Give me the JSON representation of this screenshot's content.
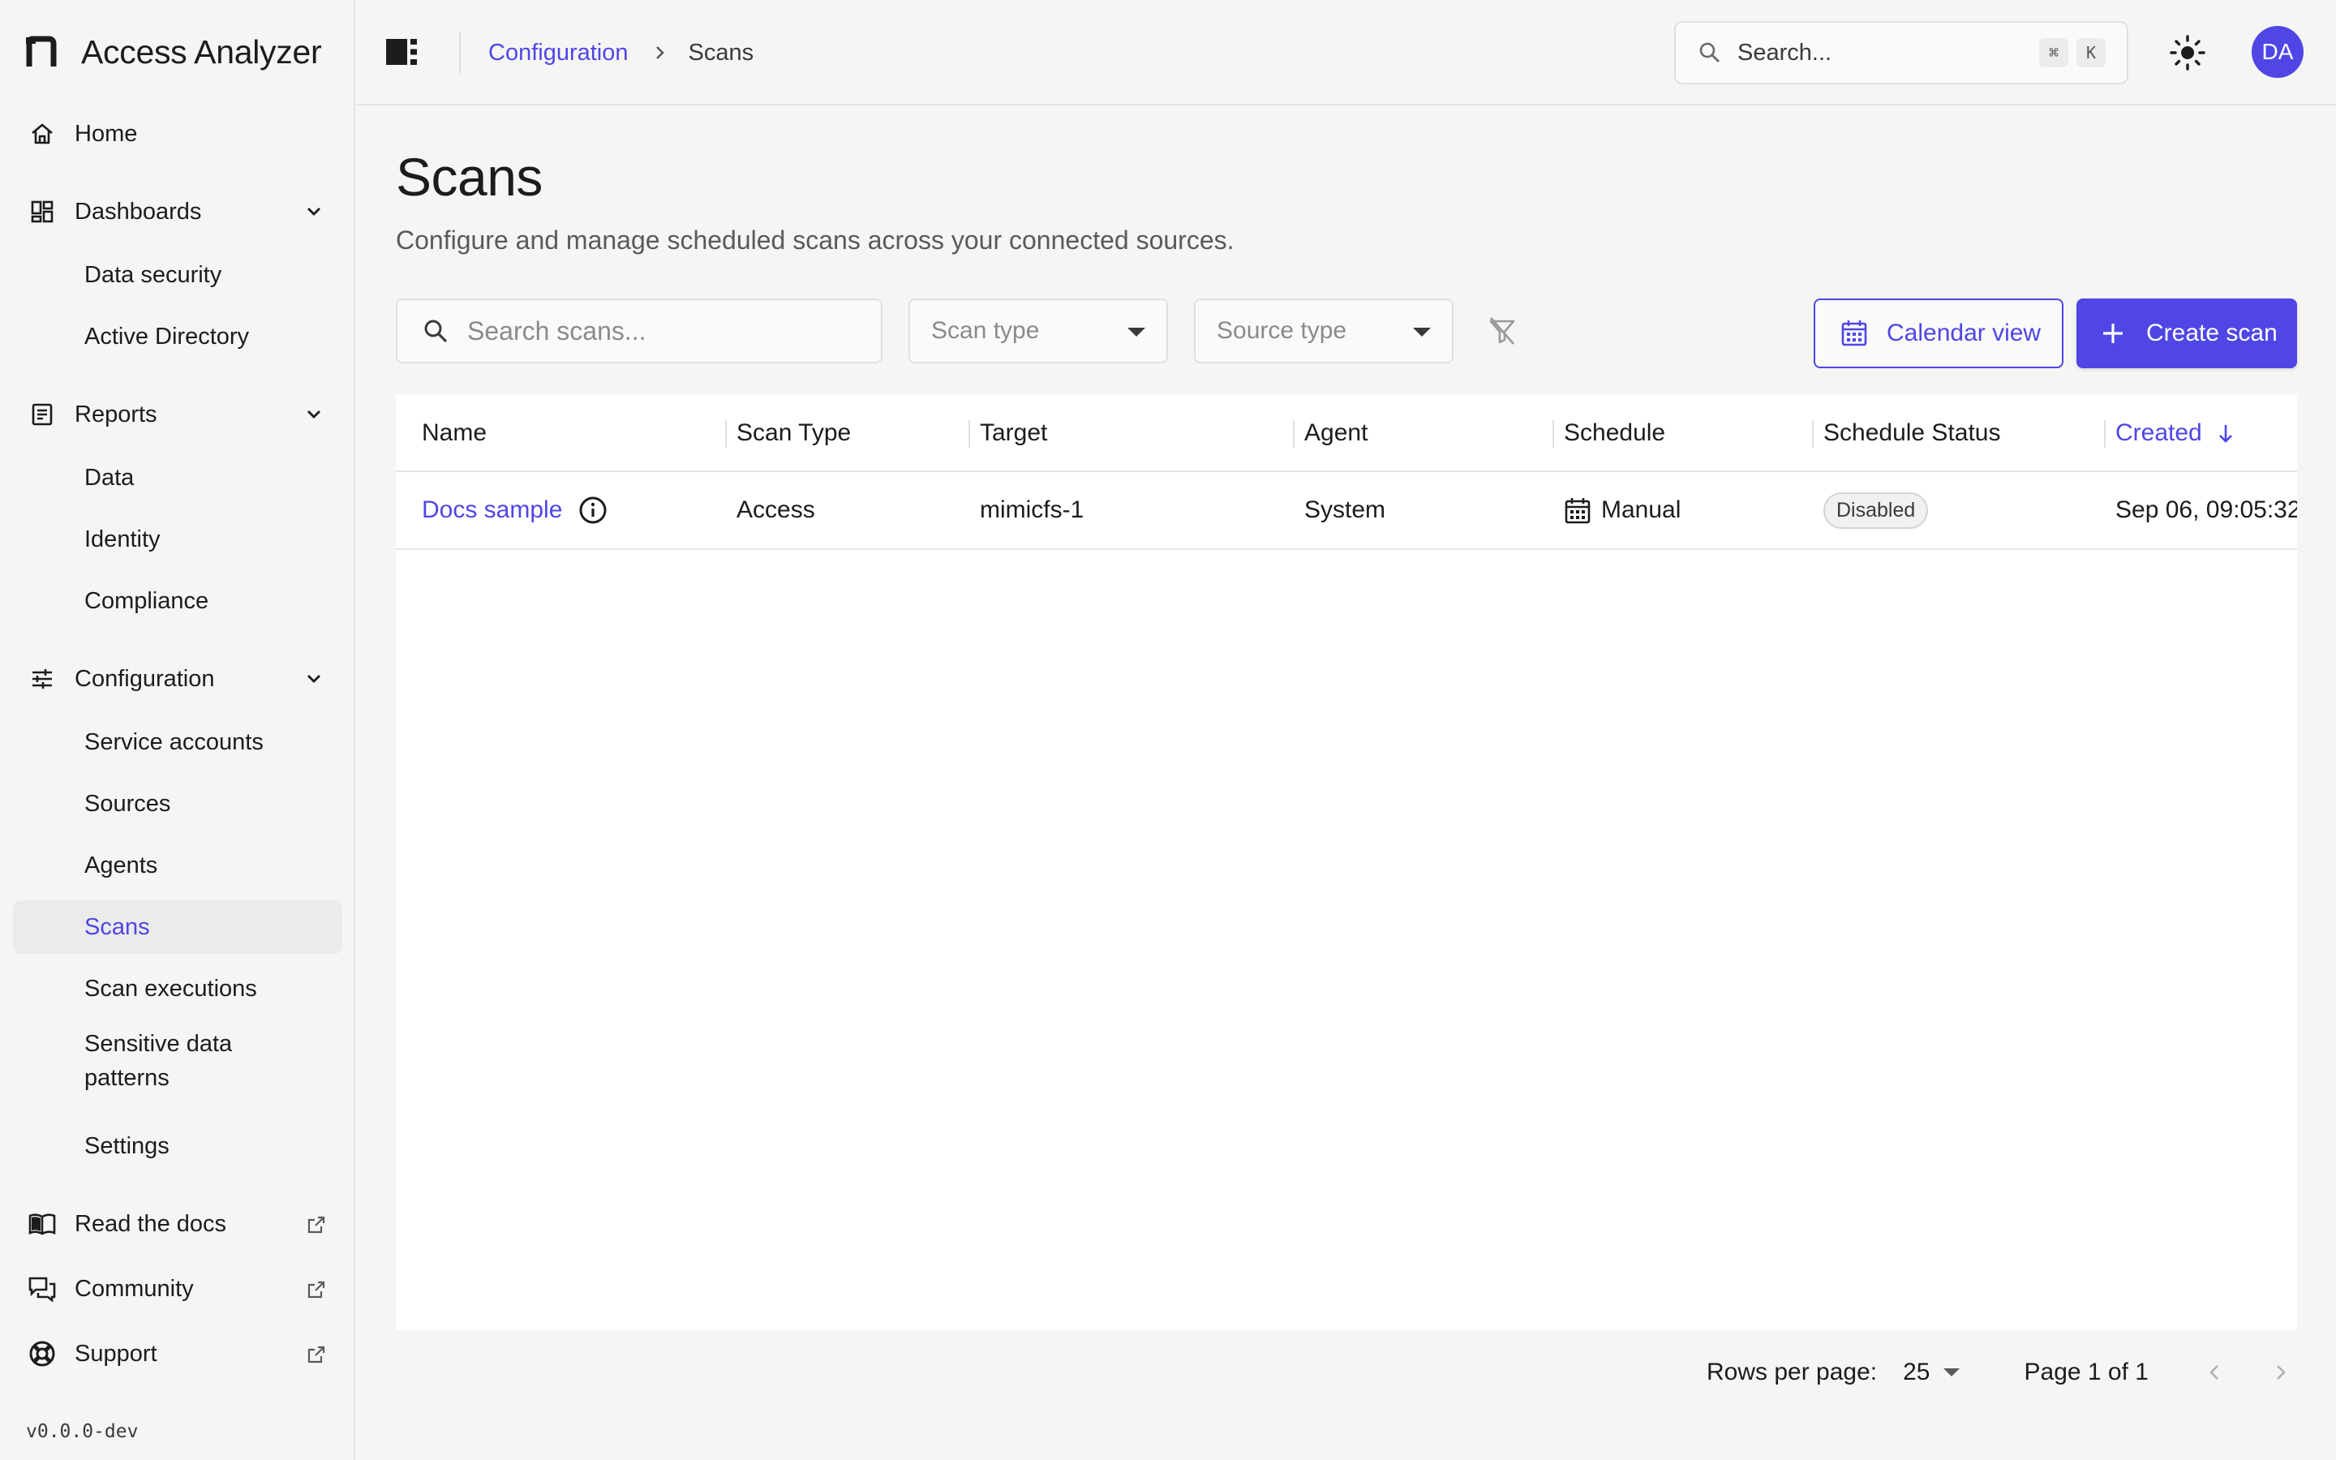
{
  "app": {
    "name": "Access Analyzer",
    "version": "v0.0.0-dev"
  },
  "colors": {
    "accent": "#4f46e5",
    "background": "#f5f5f4",
    "text": "#1c1c1e"
  },
  "sidebar": {
    "home": "Home",
    "dashboards": {
      "label": "Dashboards",
      "items": [
        "Data security",
        "Active Directory"
      ]
    },
    "reports": {
      "label": "Reports",
      "items": [
        "Data",
        "Identity",
        "Compliance"
      ]
    },
    "configuration": {
      "label": "Configuration",
      "items": [
        "Service accounts",
        "Sources",
        "Agents",
        "Scans",
        "Scan executions",
        "Sensitive data patterns",
        "Settings"
      ],
      "active": "Scans"
    },
    "links": [
      "Read the docs",
      "Community",
      "Support"
    ]
  },
  "topbar": {
    "breadcrumb": {
      "parent": "Configuration",
      "current": "Scans"
    },
    "search": {
      "placeholder": "Search...",
      "kbd1": "⌘",
      "kbd2": "K"
    },
    "avatar_initials": "DA"
  },
  "page": {
    "title": "Scans",
    "subtitle": "Configure and manage scheduled scans across your connected sources."
  },
  "toolbar": {
    "search_placeholder": "Search scans...",
    "scan_type_placeholder": "Scan type",
    "source_type_placeholder": "Source type",
    "calendar_view_label": "Calendar view",
    "create_scan_label": "Create scan"
  },
  "table": {
    "columns": [
      "Name",
      "Scan Type",
      "Target",
      "Agent",
      "Schedule",
      "Schedule Status",
      "Created"
    ],
    "sorted_column": "Created",
    "rows": [
      {
        "name": "Docs sample",
        "scan_type": "Access",
        "target": "mimicfs-1",
        "agent": "System",
        "schedule": "Manual",
        "schedule_status": "Disabled",
        "created": "Sep 06, 09:05:32"
      }
    ]
  },
  "pagination": {
    "rows_per_page_label": "Rows per page:",
    "rows_per_page": "25",
    "page_info": "Page 1 of 1"
  }
}
